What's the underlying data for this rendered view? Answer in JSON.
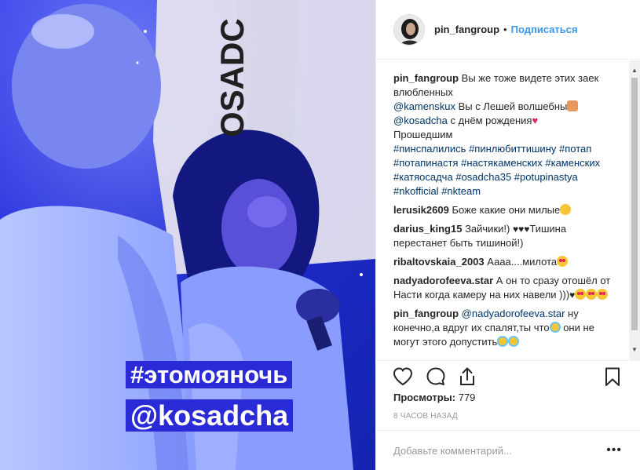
{
  "media": {
    "banner_text": "OSADC",
    "stickers": {
      "hashtag": "#этомояночь",
      "mention": "@kosadcha"
    }
  },
  "header": {
    "username": "pin_fangroup",
    "separator": "•",
    "follow_label": "Подписаться"
  },
  "caption": {
    "user": "pin_fangroup",
    "line1": "Вы же тоже видете этих заек влюбленных",
    "mention1": "@kamenskux",
    "line2": "Вы с Лешей волшебны",
    "mention2": "@kosadcha",
    "line3": "с днём рождения",
    "line4": "Прошедшим",
    "hashtags": [
      "#пинспалились",
      "#пинлюбиттишину",
      "#потап",
      "#потапинастя",
      "#настякаменских",
      "#каменских",
      "#катяосадча",
      "#osadcha35",
      "#potupinastya",
      "#nkofficial",
      "#nkteam"
    ]
  },
  "comments": [
    {
      "user": "lerusik2609",
      "text": "Боже какие они милые"
    },
    {
      "user": "darius_king15",
      "text": "Зайчики!)",
      "text2": "Тишина перестанет быть тишиной!)"
    },
    {
      "user": "ribaltovskaia_2003",
      "text": "Аааа....милота"
    },
    {
      "user": "nadyadorofeeva.star",
      "text": "А он то сразу отошёл от Насти когда камеру на них навели )))"
    },
    {
      "user": "pin_fangroup",
      "mention": "@nadyadorofeeva.star",
      "text": "ну конечно,а вдруг их спалят,ты что",
      "text2": "они не могут этого допустить"
    }
  ],
  "icons": {
    "like": "heart-outline-icon",
    "comment": "speech-bubble-icon",
    "share": "share-icon",
    "save": "bookmark-icon",
    "more": "more-options-icon"
  },
  "stats": {
    "views_label": "Просмотры:",
    "views_count": "779",
    "timestamp": "8 часов назад"
  },
  "add_comment": {
    "placeholder": "Добавьте комментарий...",
    "more_label": "•••"
  },
  "colors": {
    "link": "#003569",
    "follow": "#3897f0",
    "media_blue": "#1a2cc8"
  }
}
